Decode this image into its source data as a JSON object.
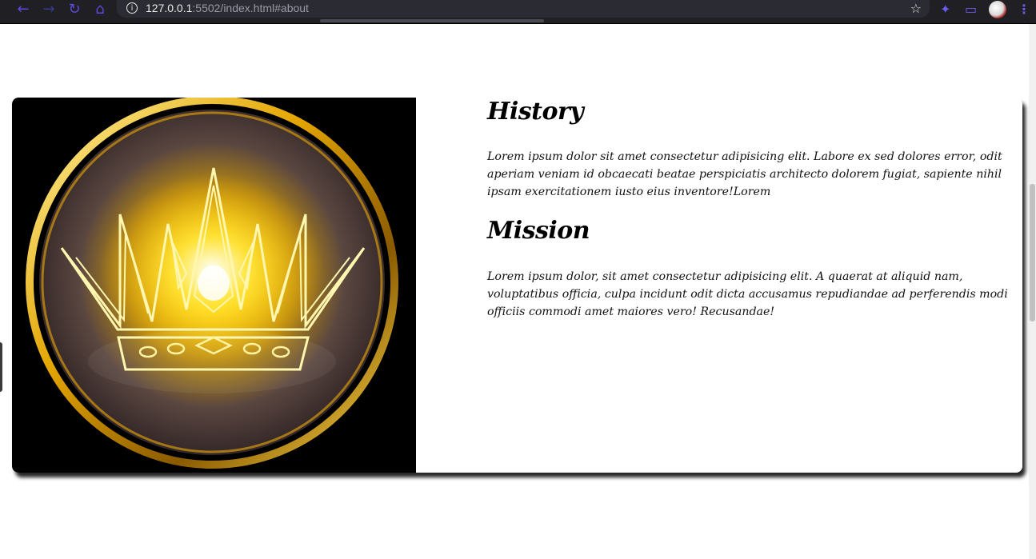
{
  "browser": {
    "url_host": "127.0.0.1",
    "url_rest": ":5502/index.html#about",
    "icons": [
      "back-arrow-icon",
      "forward-arrow-icon",
      "reload-icon",
      "home-icon",
      "info-icon",
      "star-icon",
      "extensions-icon",
      "cast-icon",
      "profile-avatar",
      "menu-icon"
    ]
  },
  "about": {
    "image_alt": "Golden crown emblem",
    "history": {
      "title": "History",
      "text": "Lorem ipsum dolor sit amet consectetur adipisicing elit. Labore ex sed dolores error, odit aperiam veniam id obcaecati beatae perspiciatis architecto dolorem fugiat, sapiente nihil ipsam exercitationem iusto eius inventore!Lorem"
    },
    "mission": {
      "title": "Mission",
      "text": "Lorem ipsum dolor, sit amet consectetur adipisicing elit. A quaerat at aliquid nam, voluptatibus officia, culpa incidunt odit dicta accusamus repudiandae ad perferendis modi officiis commodi amet maiores vero! Recusandae!"
    }
  },
  "colors": {
    "browser_bar": "#1f1f24",
    "accent": "#6b5cf0",
    "gold": "#f5c400",
    "card_shadow": "#000000"
  }
}
